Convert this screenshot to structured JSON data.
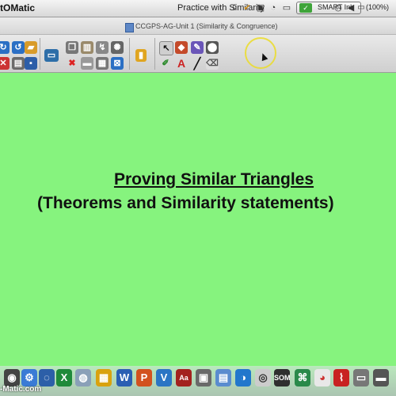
{
  "menubar": {
    "app_name": "tOMatic",
    "title": "Practice with Similarity",
    "smart_ink_label": "SMART Ink",
    "battery": "(100%)"
  },
  "window": {
    "title": "CCGPS-AG-Unit 1 (Similarity & Congruence)"
  },
  "canvas": {
    "background_color": "#86f37e",
    "heading": "Proving Similar Triangles",
    "subheading": "(Theorems and Similarity statements)"
  },
  "toolbar": {
    "icons": [
      "redo-icon",
      "undo-icon",
      "open-icon",
      "save-icon",
      "copy-icon",
      "paste-icon",
      "cut-icon",
      "screen-icon",
      "delete-icon",
      "table-icon",
      "close-icon",
      "gallery-icon",
      "lock-icon",
      "select-icon",
      "pen-icon",
      "fill-icon",
      "text-icon",
      "line-icon",
      "eraser-icon"
    ]
  },
  "dock": {
    "watermark": "-Matic.com"
  }
}
